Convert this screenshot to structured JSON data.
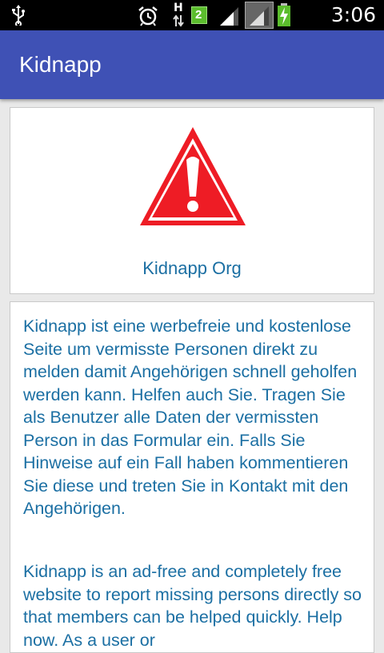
{
  "status_bar": {
    "time": "3:06 PM",
    "network_type": "H",
    "sim_badge": "2",
    "icons": [
      "usb-icon",
      "alarm-icon",
      "data-arrows-icon",
      "sim-icon",
      "signal-icon",
      "signal-icon-2",
      "battery-charging-icon"
    ]
  },
  "app_bar": {
    "title": "Kidnapp",
    "color": "#3f51b5"
  },
  "logo_card": {
    "icon": "warning-triangle-icon",
    "label": "Kidnapp Org"
  },
  "description_card": {
    "paragraph_de": "Kidnapp ist eine werbefreie und kostenlose Seite um vermisste Personen direkt zu melden damit Angehörigen schnell geholfen werden kann. Helfen auch Sie. Tragen Sie als Benutzer alle Daten der vermissten Person in das Formular ein. Falls Sie Hinweise auf ein Fall haben kommentieren Sie diese und treten Sie in Kontakt mit den Angehörigen.",
    "paragraph_en": "Kidnapp is an ad-free and completely free website to report missing persons directly so that members can be helped quickly. Help now. As a user or"
  }
}
